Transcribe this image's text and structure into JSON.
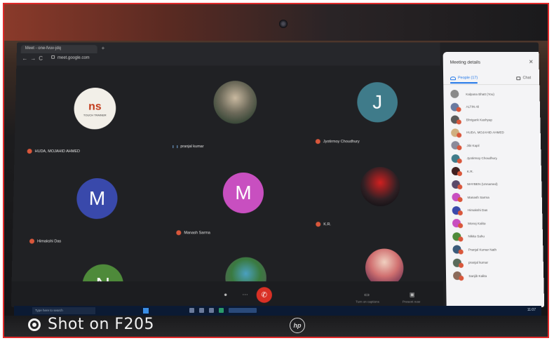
{
  "browser": {
    "tab_title": "Meet - one-fvuv-jdq",
    "new_tab_glyph": "+",
    "url": "meet.google.com",
    "nav": {
      "back": "←",
      "forward": "→",
      "reload": "C"
    }
  },
  "tiles": [
    {
      "name": "HUDA, MOJAHID AHMED",
      "initial": "",
      "style": "logo",
      "logo_text": "ns",
      "logo_sub": "TOUCH TRAINER",
      "muted": true
    },
    {
      "name": "pranjal kumar",
      "initial": "",
      "style": "photo",
      "muted": false
    },
    {
      "name": "Jyotirmoy Choudhury",
      "initial": "J",
      "color": "#3f7b8a",
      "style": "letter",
      "muted": true
    },
    {
      "name": "Himakshi Das",
      "initial": "M",
      "color": "#3949ab",
      "style": "letter",
      "muted": true
    },
    {
      "name": "Manash Sarma",
      "initial": "M",
      "color": "#c84fc0",
      "style": "letter",
      "muted": true
    },
    {
      "name": "K.R.",
      "initial": "",
      "style": "photo2",
      "muted": true
    },
    {
      "name": "",
      "initial": "N",
      "color": "#4e8a3a",
      "style": "letter",
      "muted": false
    },
    {
      "name": "",
      "initial": "",
      "style": "photo3",
      "muted": false
    },
    {
      "name": "",
      "initial": "",
      "style": "photo4",
      "muted": false
    }
  ],
  "controls": {
    "end_call_glyph": "✆",
    "labels": [
      "Turn on captions",
      "Present now"
    ]
  },
  "panel": {
    "title": "Meeting details",
    "close_glyph": "✕",
    "tab_people": "People (17)",
    "tab_chat": "Chat",
    "participants": [
      {
        "name": "Kalpana Bhatt (You)",
        "color": "#8a8a8a"
      },
      {
        "name": "ALTIN Ali",
        "color": "#6a7aa0"
      },
      {
        "name": "Bhrigank Kashyap",
        "color": "#5a5a5a"
      },
      {
        "name": "HUDA, MOJAHID AHMED",
        "color": "#d0b080"
      },
      {
        "name": "Jibi Kapil",
        "color": "#8a8a9a"
      },
      {
        "name": "Jyotirmoy Choudhury",
        "color": "#3f7b8a"
      },
      {
        "name": "K.R.",
        "color": "#402020"
      },
      {
        "name": "MAYBEN (Unnamed)",
        "color": "#5a4a6a"
      },
      {
        "name": "Manash Sarma",
        "color": "#c84fc0"
      },
      {
        "name": "Himakshi Das",
        "color": "#3949ab"
      },
      {
        "name": "Monoj Kalita",
        "color": "#c84fc0"
      },
      {
        "name": "Nikita Sahu",
        "color": "#4e8a3a"
      },
      {
        "name": "Pranjal Kumar Nath",
        "color": "#3a5a7a"
      },
      {
        "name": "pranjal kumar",
        "color": "#5a6a5a"
      },
      {
        "name": "Sanjib Kalita",
        "color": "#8a6a5a"
      }
    ]
  },
  "taskbar": {
    "search_placeholder": "Type here to search",
    "clock": "11:07"
  },
  "overlay": {
    "shot_text": "Shot on F205",
    "brand_logo": "hp"
  }
}
